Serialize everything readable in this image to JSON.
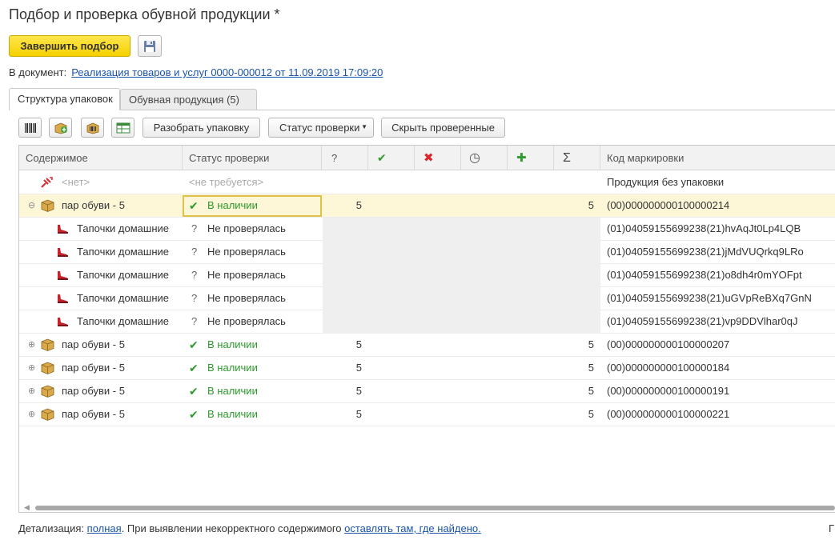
{
  "window": {
    "title": "Подбор и проверка обувной продукции *"
  },
  "toolbar": {
    "finish_label": "Завершить подбор",
    "save_icon": "floppy-disk-icon"
  },
  "document": {
    "prefix": "В документ:",
    "link": "Реализация товаров и услуг 0000-000012 от 11.09.2019 17:09:20"
  },
  "tabs": [
    {
      "label": "Структура упаковок"
    },
    {
      "label": "Обувная продукция (5)"
    }
  ],
  "actions": {
    "unpack": "Разобрать упаковку",
    "status_menu": "Статус проверки",
    "hide_checked": "Скрыть проверенные"
  },
  "table": {
    "headers": {
      "content": "Содержимое",
      "status": "Статус проверки",
      "unknown": "?",
      "ok": "✔",
      "error": "✖",
      "pending": "◷",
      "plus": "✚",
      "sigma": "Σ",
      "code": "Код маркировки"
    },
    "rows": [
      {
        "kind": "none",
        "content": "<нет>",
        "status": "<не требуется>",
        "code": "Продукция без упаковки"
      },
      {
        "kind": "pack",
        "expanded": true,
        "content": "пар обуви - 5",
        "status": "В наличии",
        "q": "5",
        "sum": "5",
        "code": "(00)000000000100000214"
      },
      {
        "kind": "item",
        "content": "Тапочки домашние",
        "status": "Не проверялась",
        "code": "(01)04059155699238(21)hvAqJt0Lp4LQB"
      },
      {
        "kind": "item",
        "content": "Тапочки домашние",
        "status": "Не проверялась",
        "code": "(01)04059155699238(21)jMdVUQrkq9LRo"
      },
      {
        "kind": "item",
        "content": "Тапочки домашние",
        "status": "Не проверялась",
        "code": "(01)04059155699238(21)o8dh4r0mYOFpt"
      },
      {
        "kind": "item",
        "content": "Тапочки домашние",
        "status": "Не проверялась",
        "code": "(01)04059155699238(21)uGVpReBXq7GnN"
      },
      {
        "kind": "item",
        "content": "Тапочки домашние",
        "status": "Не проверялась",
        "code": "(01)04059155699238(21)vp9DDVlhar0qJ"
      },
      {
        "kind": "pack",
        "expanded": false,
        "content": "пар обуви - 5",
        "status": "В наличии",
        "q": "5",
        "sum": "5",
        "code": "(00)000000000100000207"
      },
      {
        "kind": "pack",
        "expanded": false,
        "content": "пар обуви - 5",
        "status": "В наличии",
        "q": "5",
        "sum": "5",
        "code": "(00)000000000100000184"
      },
      {
        "kind": "pack",
        "expanded": false,
        "content": "пар обуви - 5",
        "status": "В наличии",
        "q": "5",
        "sum": "5",
        "code": "(00)000000000100000191"
      },
      {
        "kind": "pack",
        "expanded": false,
        "content": "пар обуви - 5",
        "status": "В наличии",
        "q": "5",
        "sum": "5",
        "code": "(00)000000000100000221"
      }
    ]
  },
  "footer": {
    "detail_prefix": "Детализация:",
    "detail_link": "полная",
    "middle": ". При выявлении некорректного содержимого",
    "action_link": "оставлять там, где найдено.",
    "right_text": "Г"
  },
  "colors": {
    "primary_button": "#f5d100",
    "link": "#1a54a8",
    "ok_green": "#2e9a2e",
    "error_red": "#d9262b",
    "selected_row": "#fdf7d8"
  }
}
